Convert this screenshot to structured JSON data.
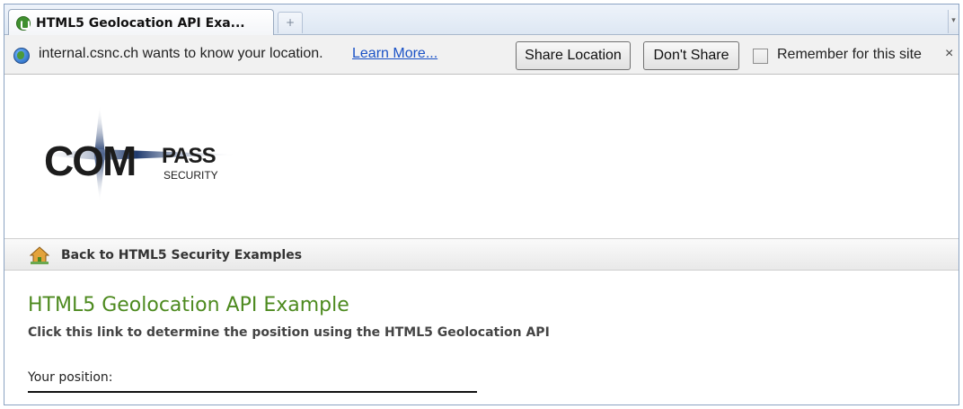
{
  "browser": {
    "tab": {
      "title": "HTML5 Geolocation API Exa...",
      "close": "×",
      "icon": "compass-favicon-icon"
    },
    "new_tab": "+",
    "tab_scroll": "▾"
  },
  "notification": {
    "message": "internal.csnc.ch wants to know your location.",
    "learn_more": "Learn More...",
    "share_button": "Share Location",
    "dont_share_button": "Don't Share",
    "remember_label": "Remember for this site",
    "remember_checked": false,
    "close": "×"
  },
  "page": {
    "logo": {
      "big": "COM",
      "pass": "PASS",
      "security": "SECURITY"
    },
    "back_link": "Back to HTML5 Security Examples",
    "title": "HTML5 Geolocation API Example",
    "action_link": "Click this link to determine the position using the HTML5 Geolocation API",
    "position_label": "Your position:"
  },
  "colors": {
    "title_green": "#4d8a1f",
    "link_blue": "#1a52c6"
  }
}
